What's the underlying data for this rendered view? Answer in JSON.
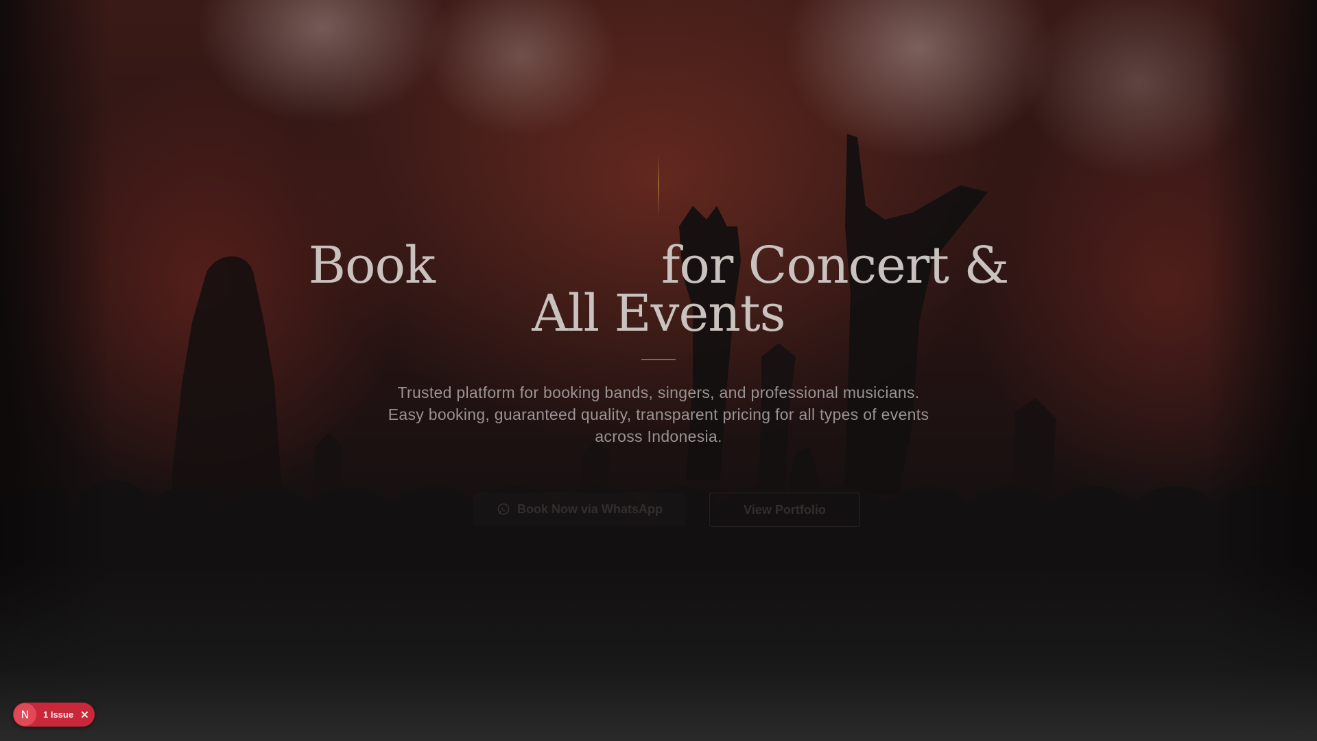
{
  "hero": {
    "headline_book": "Book",
    "headline_rest": "for Concert &",
    "headline_line2": "All Events",
    "subtitle": "Trusted platform for booking bands, singers, and professional musicians. Easy booking, guaranteed quality, transparent pricing for all types of events across Indonesia.",
    "buttons": {
      "whatsapp_label": "Book Now via WhatsApp",
      "portfolio_label": "View Portfolio"
    }
  },
  "dev_overlay": {
    "logo_letter": "N",
    "issue_label": "1 Issue",
    "close_glyph": "✕"
  },
  "colors": {
    "accent_gold": "#8a6a32",
    "badge_red": "#c8283a",
    "headline_text": "#c9c2bf"
  },
  "icons": {
    "whatsapp": "whatsapp-icon",
    "close": "close-icon"
  }
}
